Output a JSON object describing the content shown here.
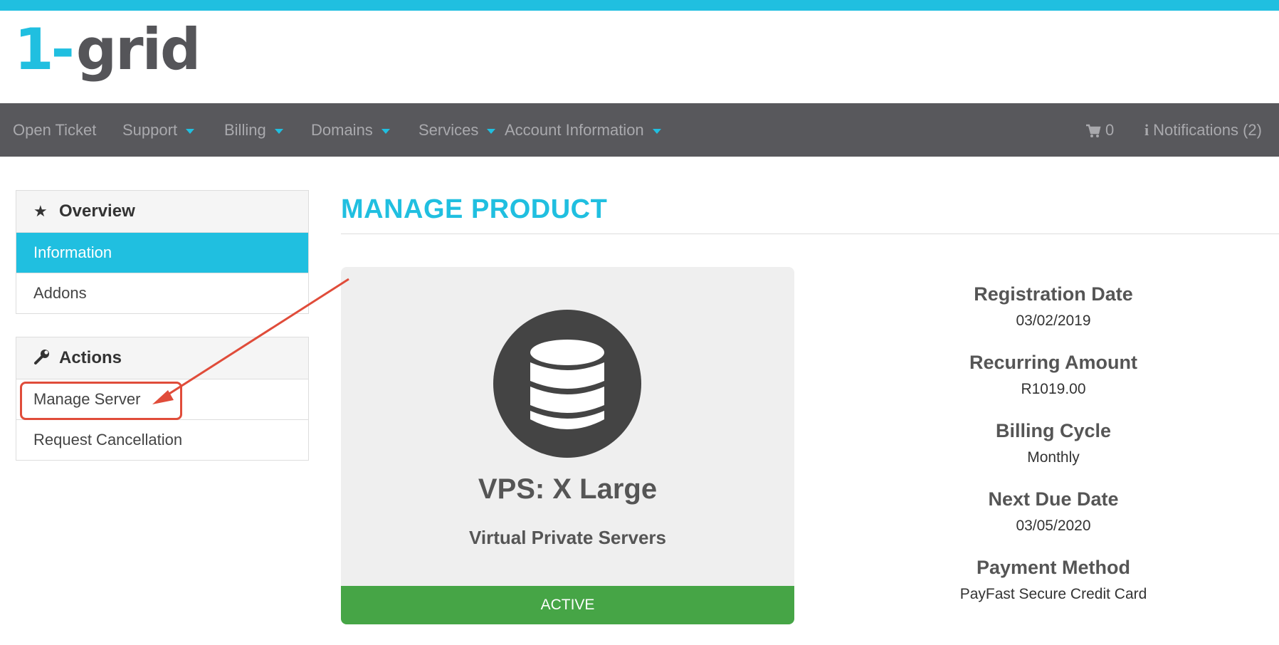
{
  "brand": {
    "logo_one": "1",
    "logo_dash": "-",
    "logo_grid": "grid",
    "accent_color": "#20bfe0",
    "nav_color": "#58585c"
  },
  "navbar": {
    "items": [
      {
        "label": "Open Ticket",
        "dropdown": false
      },
      {
        "label": "Support",
        "dropdown": true
      },
      {
        "label": "Billing",
        "dropdown": true
      },
      {
        "label": "Domains",
        "dropdown": true
      },
      {
        "label": "Services",
        "dropdown": true
      },
      {
        "label": "Account Information",
        "dropdown": true
      }
    ],
    "cart_icon": "shopping-cart-icon",
    "cart_count": "0",
    "notifications_icon": "info-icon",
    "notifications_label": "Notifications (2)"
  },
  "sidebar": {
    "overview": {
      "title": "Overview",
      "icon": "star-icon",
      "items": [
        {
          "label": "Information",
          "active": true
        },
        {
          "label": "Addons",
          "active": false
        }
      ]
    },
    "actions": {
      "title": "Actions",
      "icon": "wrench-icon",
      "items": [
        {
          "label": "Manage Server",
          "highlighted": true
        },
        {
          "label": "Request Cancellation",
          "highlighted": false
        }
      ]
    }
  },
  "main": {
    "page_title": "MANAGE PRODUCT",
    "product": {
      "icon": "database-icon",
      "name": "VPS: X Large",
      "group": "Virtual Private Servers",
      "status": "ACTIVE",
      "status_color": "#46a546"
    },
    "details": [
      {
        "label": "Registration Date",
        "value": "03/02/2019"
      },
      {
        "label": "Recurring Amount",
        "value": "R1019.00"
      },
      {
        "label": "Billing Cycle",
        "value": "Monthly"
      },
      {
        "label": "Next Due Date",
        "value": "03/05/2020"
      },
      {
        "label": "Payment Method",
        "value": "PayFast Secure Credit Card"
      }
    ]
  },
  "annotation": {
    "color": "#e04c3a"
  }
}
